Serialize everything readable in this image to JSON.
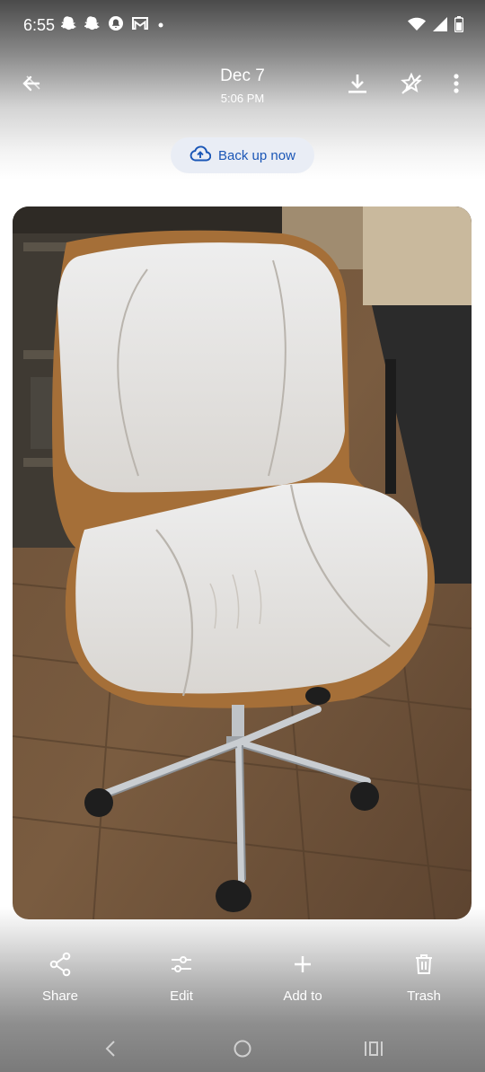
{
  "status": {
    "time": "6:55",
    "left_icons": [
      "snapchat-icon",
      "snapchat-icon",
      "notification-bell-icon",
      "gmail-icon",
      "dot-icon"
    ],
    "right_icons": [
      "wifi-icon",
      "signal-icon",
      "battery-icon"
    ]
  },
  "header": {
    "date": "Dec 7",
    "time": "5:06 PM"
  },
  "backup": {
    "label": "Back up now"
  },
  "photo": {
    "subject": "white-office-chair-photo"
  },
  "actions": [
    {
      "label": "Share",
      "icon": "share-icon"
    },
    {
      "label": "Edit",
      "icon": "edit-sliders-icon"
    },
    {
      "label": "Add to",
      "icon": "plus-icon"
    },
    {
      "label": "Trash",
      "icon": "trash-icon"
    }
  ],
  "nav": [
    "back-nav-icon",
    "home-nav-icon",
    "recents-nav-icon"
  ],
  "colors": {
    "accent": "#1a56b6",
    "backup_bg": "#e9edf5"
  }
}
